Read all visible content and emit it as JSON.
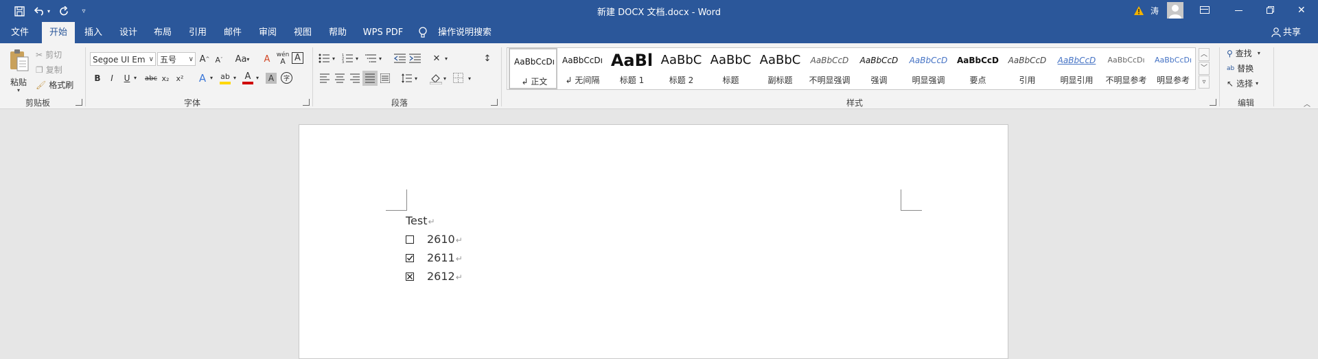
{
  "window": {
    "title": "新建 DOCX 文档.docx  -  Word",
    "user_name": "涛"
  },
  "quick_access": {
    "save_icon": "save-icon",
    "undo_icon": "undo-icon",
    "redo_icon": "redo-icon",
    "customize_icon": "customize-qat-icon"
  },
  "window_controls": {
    "ribbon_display_icon": "ribbon-display-icon",
    "minimize_icon": "minimize-icon",
    "restore_icon": "restore-icon",
    "close_icon": "close-icon"
  },
  "tabs": [
    "文件",
    "开始",
    "插入",
    "设计",
    "布局",
    "引用",
    "邮件",
    "审阅",
    "视图",
    "帮助",
    "WPS PDF"
  ],
  "active_tab": "开始",
  "tell_me": "操作说明搜索",
  "share": "共享",
  "clipboard": {
    "paste": "粘贴",
    "cut": "剪切",
    "copy": "复制",
    "format_painter": "格式刷",
    "group": "剪贴板"
  },
  "font": {
    "name": "Segoe UI Em",
    "size": "五号",
    "group": "字体",
    "grow": "A",
    "shrink": "A",
    "case": "Aa",
    "clear": "A",
    "phonetic": "wén",
    "border": "A",
    "bold": "B",
    "italic": "I",
    "underline": "U",
    "strike": "abc",
    "subscript": "x₂",
    "superscript": "x²",
    "effects": "A",
    "highlight": "ab",
    "color": "A",
    "shading": "A",
    "enclose": "字"
  },
  "paragraph": {
    "group": "段落"
  },
  "styles": {
    "group": "样式",
    "items": [
      {
        "sample": "AaBbCcDı",
        "name": "正文"
      },
      {
        "sample": "AaBbCcDı",
        "name": "无间隔"
      },
      {
        "sample": "AaBl",
        "name": "标题 1"
      },
      {
        "sample": "AaBbC",
        "name": "标题 2"
      },
      {
        "sample": "AaBbC",
        "name": "标题"
      },
      {
        "sample": "AaBbC",
        "name": "副标题"
      },
      {
        "sample": "AaBbCcD",
        "name": "不明显强调"
      },
      {
        "sample": "AaBbCcD",
        "name": "强调"
      },
      {
        "sample": "AaBbCcD",
        "name": "明显强调"
      },
      {
        "sample": "AaBbCcD",
        "name": "要点"
      },
      {
        "sample": "AaBbCcD",
        "name": "引用"
      },
      {
        "sample": "AaBbCcD",
        "name": "明显引用"
      },
      {
        "sample": "AaBbCcDı",
        "name": "不明显参考"
      },
      {
        "sample": "AaBbCcDı",
        "name": "明显参考"
      }
    ]
  },
  "editing": {
    "find": "查找",
    "replace": "替换",
    "select": "选择",
    "group": "编辑"
  },
  "document": {
    "lines": [
      {
        "text": "Test",
        "checkbox": null
      },
      {
        "text": "2610",
        "checkbox": "empty"
      },
      {
        "text": "2611",
        "checkbox": "checked"
      },
      {
        "text": "2612",
        "checkbox": "crossed"
      }
    ],
    "paragraph_mark": "↵"
  },
  "colors": {
    "titlebar": "#2b579a",
    "ribbon": "#f3f3f3",
    "canvas": "#e6e6e6",
    "highlight": "#ffd700",
    "font_color": "#d00000",
    "warning": "#f2b200"
  }
}
